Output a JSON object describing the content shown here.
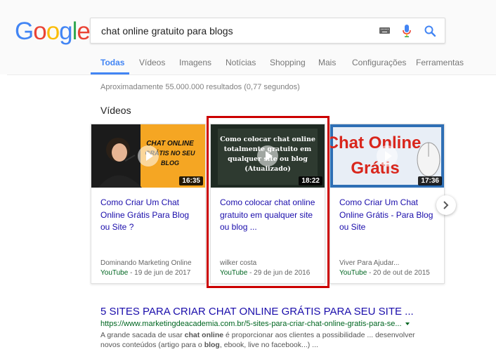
{
  "logo": {
    "letters": [
      "G",
      "o",
      "o",
      "g",
      "l",
      "e"
    ],
    "colors": [
      "#4285F4",
      "#EA4335",
      "#FBBC05",
      "#4285F4",
      "#34A853",
      "#EA4335"
    ]
  },
  "search": {
    "query": "chat online gratuito para blogs"
  },
  "tabs": [
    {
      "label": "Todas",
      "active": true
    },
    {
      "label": "Vídeos"
    },
    {
      "label": "Imagens"
    },
    {
      "label": "Notícias"
    },
    {
      "label": "Shopping"
    },
    {
      "label": "Mais"
    },
    {
      "label": "Configurações"
    },
    {
      "label": "Ferramentas"
    }
  ],
  "stats": "Aproximadamente 55.000.000 resultados (0,77 segundos)",
  "videos_heading": "Vídeos",
  "videos": [
    {
      "thumb_text": "CHAT ONLINE GRÁTIS NO SEU BLOG",
      "duration": "16:35",
      "title": "Como Criar Um Chat Online Grátis Para Blog ou Site ?",
      "source": "Dominando Marketing Online",
      "platform": "YouTube",
      "date": " - 19 de jun de 2017"
    },
    {
      "thumb_text": "Como colocar chat online totalmente gratuito em qualquer site ou blog (Atualizado)",
      "duration": "18:22",
      "title": "Como colocar chat online gratuito em qualquer site ou blog ...",
      "source": "wilker costa",
      "platform": "YouTube",
      "date": " - 29 de jun de 2016"
    },
    {
      "thumb_text": "Chat Online Grátis",
      "duration": "17:36",
      "title": "Como Criar Um Chat Online Grátis - Para Blog ou Site",
      "source": "Viver Para Ajudar...",
      "platform": "YouTube",
      "date": " - 20 de out de 2015"
    }
  ],
  "result": {
    "title": "5 SITES PARA CRIAR CHAT ONLINE GRÁTIS PARA SEU SITE ...",
    "url": "https://www.marketingdeacademia.com.br/5-sites-para-criar-chat-online-gratis-para-se...",
    "snippet_1": "A grande sacada de usar ",
    "snippet_bold_1": "chat online",
    "snippet_2": " é proporcionar aos clientes a possibilidade ... desenvolver novos conteúdos (artigo para o ",
    "snippet_bold_2": "blog",
    "snippet_3": ", ebook, live no facebook...) ..."
  },
  "colors": {
    "link": "#1a0dab",
    "url_green": "#006621",
    "active_tab": "#4285f4",
    "highlight": "#cc0000"
  }
}
